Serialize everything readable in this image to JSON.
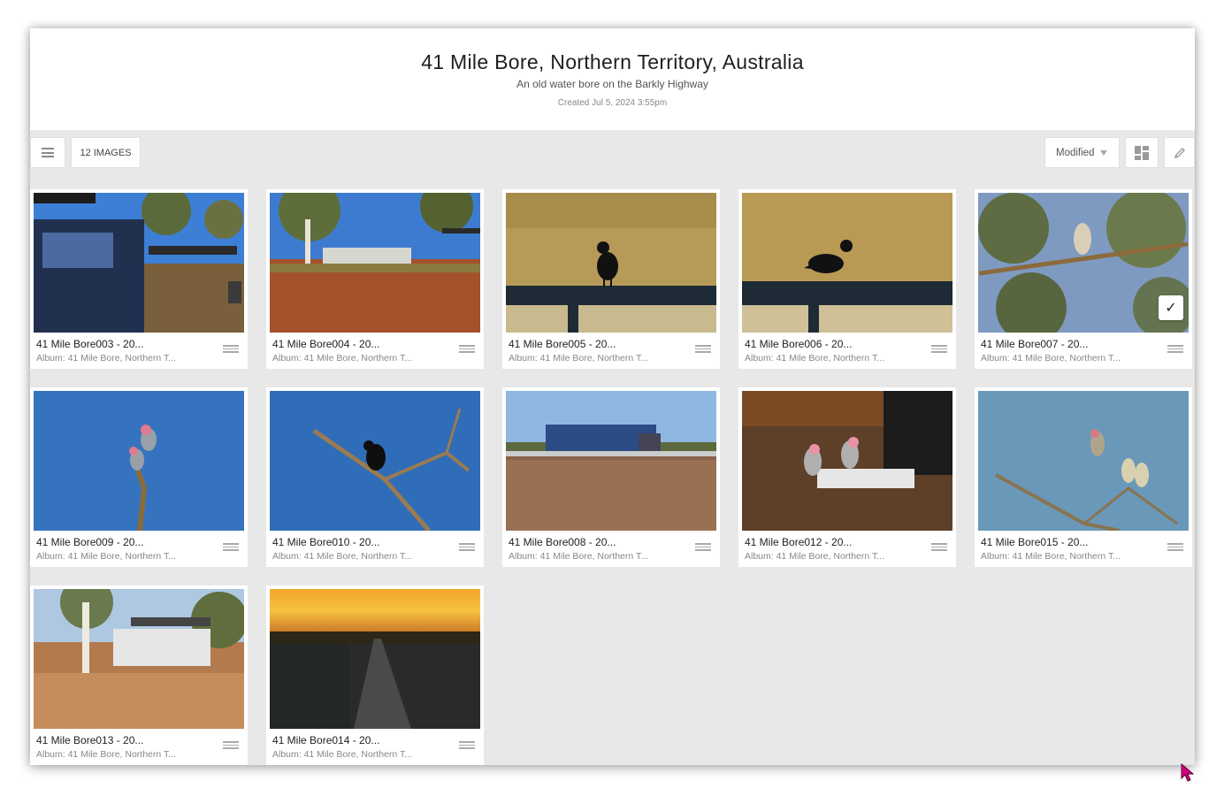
{
  "album": {
    "title": "41 Mile Bore, Northern Territory, Australia",
    "subtitle": "An old water bore on the Barkly Highway",
    "created": "Created Jul 5, 2024 3:55pm"
  },
  "toolbar": {
    "image_count": "12 IMAGES",
    "sort_label": "Modified",
    "menu_icon": "hamburger-menu-icon",
    "layout_icon": "grid-layout-icon",
    "edit_icon": "pencil-icon"
  },
  "colors": {
    "background": "#e8e8e8",
    "card": "#ffffff",
    "text": "#222222"
  },
  "images": [
    {
      "title": "41 Mile Bore003 - 20...",
      "album": "Album: 41 Mile Bore, Northern T...",
      "scene": "camp-vehicle",
      "selected": false
    },
    {
      "title": "41 Mile Bore004 - 20...",
      "album": "Album: 41 Mile Bore, Northern T...",
      "scene": "camp-trees",
      "selected": false
    },
    {
      "title": "41 Mile Bore005 - 20...",
      "album": "Album: 41 Mile Bore, Northern T...",
      "scene": "crow-bench",
      "selected": false
    },
    {
      "title": "41 Mile Bore006 - 20...",
      "album": "Album: 41 Mile Bore, Northern T...",
      "scene": "crow-bench-2",
      "selected": false
    },
    {
      "title": "41 Mile Bore007 - 20...",
      "album": "Album: 41 Mile Bore, Northern T...",
      "scene": "bird-tree",
      "selected": true
    },
    {
      "title": "41 Mile Bore009 - 20...",
      "album": "Album: 41 Mile Bore, Northern T...",
      "scene": "galahs-branch",
      "selected": false
    },
    {
      "title": "41 Mile Bore010 - 20...",
      "album": "Album: 41 Mile Bore, Northern T...",
      "scene": "crow-branch",
      "selected": false
    },
    {
      "title": "41 Mile Bore008 - 20...",
      "album": "Album: 41 Mile Bore, Northern T...",
      "scene": "road-train",
      "selected": false
    },
    {
      "title": "41 Mile Bore012 - 20...",
      "album": "Album: 41 Mile Bore, Northern T...",
      "scene": "galahs-ground",
      "selected": false
    },
    {
      "title": "41 Mile Bore015 - 20...",
      "album": "Album: 41 Mile Bore, Northern T...",
      "scene": "birds-sky",
      "selected": false
    },
    {
      "title": "41 Mile Bore013 - 20...",
      "album": "Album: 41 Mile Bore, Northern T...",
      "scene": "caravan-camp",
      "selected": false
    },
    {
      "title": "41 Mile Bore014 - 20...",
      "album": "Album: 41 Mile Bore, Northern T...",
      "scene": "sunset-road",
      "selected": false
    }
  ]
}
